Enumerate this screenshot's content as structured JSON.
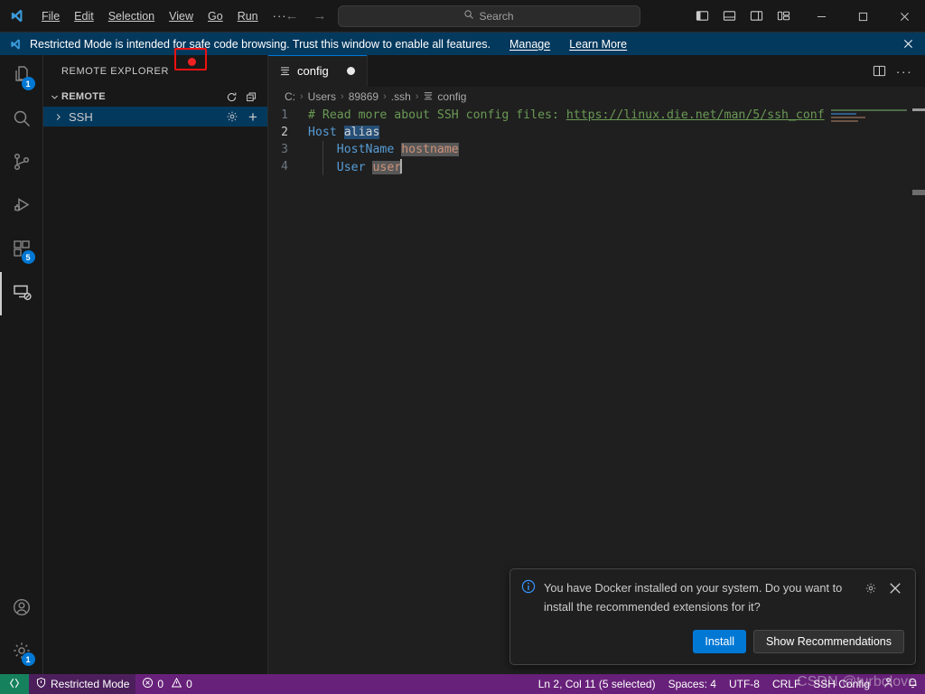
{
  "titlebar": {
    "logo_icon": "vscode-logo-icon",
    "menus": [
      {
        "label": "File",
        "accel": "F"
      },
      {
        "label": "Edit",
        "accel": "E"
      },
      {
        "label": "Selection",
        "accel": "S"
      },
      {
        "label": "View",
        "accel": "V"
      },
      {
        "label": "Go",
        "accel": "G"
      },
      {
        "label": "Run",
        "accel": "R"
      }
    ],
    "overflow_label": "···",
    "back_arrow": "←",
    "forward_arrow": "→",
    "search_placeholder": "Search",
    "search_value": "",
    "layout_buttons": [
      {
        "name": "toggle-primary-sidebar-icon"
      },
      {
        "name": "toggle-panel-icon"
      },
      {
        "name": "toggle-secondary-sidebar-icon"
      },
      {
        "name": "customize-layout-icon"
      }
    ],
    "window_controls": {
      "minimize": "minimize-icon",
      "maximize": "maximize-icon",
      "close": "close-icon"
    }
  },
  "banner": {
    "text": "Restricted Mode is intended for safe code browsing. Trust this window to enable all features.",
    "links": [
      "Manage",
      "Learn More"
    ],
    "close_icon": "close-icon",
    "background": "#04395e"
  },
  "activitybar": {
    "items": [
      {
        "name": "explorer",
        "icon": "files-icon",
        "badge": "1",
        "active": false
      },
      {
        "name": "search",
        "icon": "search-icon",
        "badge": "",
        "active": false
      },
      {
        "name": "source-control",
        "icon": "source-control-icon",
        "badge": "",
        "active": false
      },
      {
        "name": "run-and-debug",
        "icon": "debug-icon",
        "badge": "",
        "active": false
      },
      {
        "name": "extensions",
        "icon": "extensions-icon",
        "badge": "5",
        "active": false
      },
      {
        "name": "remote-explorer",
        "icon": "remote-explorer-icon",
        "badge": "",
        "active": true
      }
    ],
    "bottom_items": [
      {
        "name": "accounts",
        "icon": "account-icon",
        "badge": ""
      },
      {
        "name": "manage",
        "icon": "gear-icon",
        "badge": "1"
      }
    ],
    "badge_color": "#0078d4"
  },
  "sidebar": {
    "title": "REMOTE EXPLORER",
    "section": {
      "label": "REMOTE",
      "expanded": true,
      "actions": [
        {
          "name": "refresh-icon"
        },
        {
          "name": "collapse-all-icon"
        }
      ]
    },
    "tree": [
      {
        "label": "SSH",
        "expanded": false,
        "selected": true,
        "actions": [
          {
            "name": "configure-gear-icon",
            "highlighted": true
          },
          {
            "name": "add-new-icon",
            "glyph": "+"
          }
        ]
      }
    ]
  },
  "editor": {
    "tabs": [
      {
        "label": "config",
        "icon": "file-icon",
        "dirty": true,
        "active": true
      }
    ],
    "tab_actions": [
      {
        "name": "split-editor-icon"
      },
      {
        "name": "more-actions-icon",
        "glyph": "···"
      }
    ],
    "breadcrumbs": [
      "C:",
      "Users",
      "89869",
      ".ssh",
      "config"
    ],
    "breadcrumb_separator": "›",
    "lines": [
      {
        "number": "1",
        "active": false,
        "tokens": [
          {
            "text": "# Read more about SSH config files: ",
            "type": "comment"
          },
          {
            "text": "https://linux.die.net/man/5/ssh_conf",
            "type": "url"
          }
        ]
      },
      {
        "number": "2",
        "active": true,
        "tokens": [
          {
            "text": "Host ",
            "type": "key"
          },
          {
            "text": "alias",
            "type": "selected"
          }
        ]
      },
      {
        "number": "3",
        "active": false,
        "tokens": [
          {
            "text": "    HostName ",
            "type": "key"
          },
          {
            "text": "hostname",
            "type": "value-highlighted"
          }
        ]
      },
      {
        "number": "4",
        "active": false,
        "tokens": [
          {
            "text": "    User ",
            "type": "key"
          },
          {
            "text": "user",
            "type": "value-highlighted"
          },
          {
            "text": "",
            "type": "caret"
          }
        ]
      }
    ],
    "colors": {
      "comment": "#6a9955",
      "keyword": "#569cd6",
      "value": "#ce9178",
      "selection": "#264f78",
      "word_highlight": "#575757",
      "background": "#1f1f1f"
    }
  },
  "notification": {
    "icon": "info-icon",
    "message": "You have Docker installed on your system. Do you want to install the recommended extensions for it?",
    "gear_icon": "gear-icon",
    "close_icon": "close-icon",
    "buttons": [
      {
        "label": "Install",
        "style": "primary"
      },
      {
        "label": "Show Recommendations",
        "style": "secondary"
      }
    ]
  },
  "statusbar": {
    "background": "#68217a",
    "remote_indicator": {
      "icon": "remote-icon",
      "label": ""
    },
    "left_items": [
      {
        "name": "restricted-mode",
        "icon": "shield-icon",
        "label": "Restricted Mode"
      },
      {
        "name": "problems",
        "icon": "error-warning-icon",
        "label": "0  0",
        "errors": "0",
        "warnings": "0"
      }
    ],
    "right_items": [
      {
        "name": "editor-selection",
        "label": "Ln 2, Col 11 (5 selected)"
      },
      {
        "name": "indentation",
        "label": "Spaces: 4"
      },
      {
        "name": "encoding",
        "label": "UTF-8"
      },
      {
        "name": "eol",
        "label": "CRLF"
      },
      {
        "name": "language-mode",
        "label": "SSH Config"
      },
      {
        "name": "screencast-mode",
        "icon": "person-icon",
        "label": ""
      },
      {
        "name": "notifications-bell",
        "icon": "bell-icon",
        "label": ""
      }
    ]
  },
  "watermark": {
    "text": "CSDN @turbolove"
  }
}
